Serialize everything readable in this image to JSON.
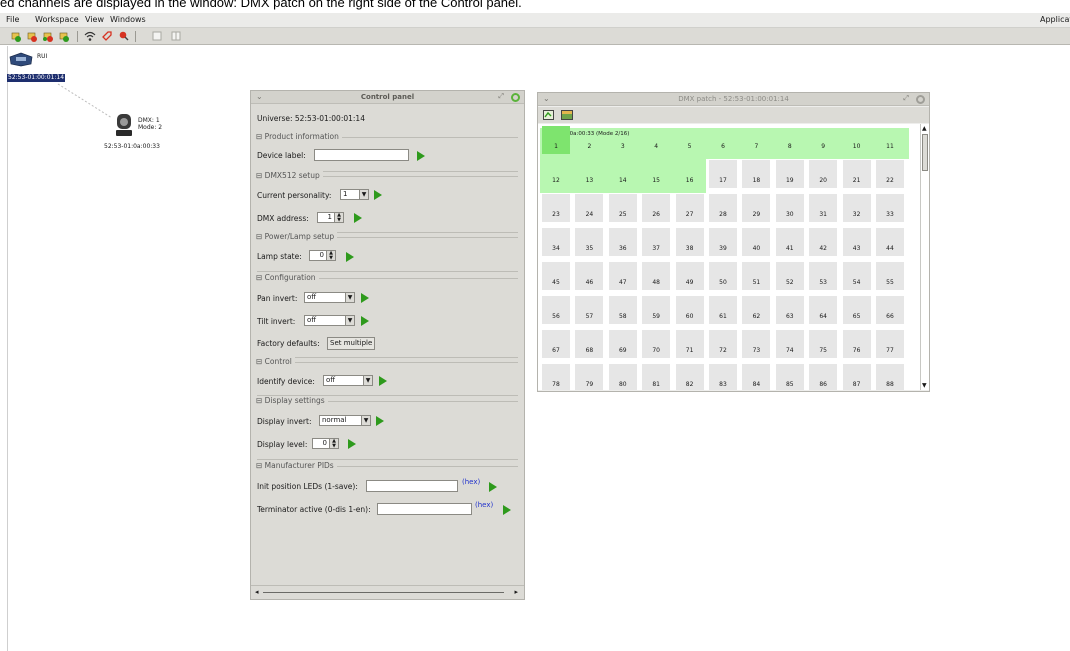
{
  "caption": "ed channels are displayed in the window: DMX patch on the right side of the Control panel.",
  "menu": {
    "file": "File",
    "workspace": "Workspace",
    "view": "View",
    "windows": "Windows",
    "right": "Applicati"
  },
  "toolbar_icons": [
    "add-device-icon",
    "remove-device-icon",
    "device-settings-icon",
    "patch-icon",
    "wifi-icon",
    "tag-icon",
    "pin-icon",
    "doc-icon",
    "grid-icon"
  ],
  "workspace": {
    "rui_label": "RUI",
    "rui_uid": "52:53-01:00:01:14",
    "fixture_dmx": "DMX: 1",
    "fixture_mode": "Mode: 2",
    "fixture_uid": "52:53-01:0a:00:33"
  },
  "control_panel": {
    "title": "Control panel",
    "universe": "Universe: 52:53-01:00:01:14",
    "product_info": "Product information",
    "device_label": "Device label:",
    "device_label_value": "",
    "dmx512_setup": "DMX512 setup",
    "current_personality": "Current personality:",
    "personality_value": "1",
    "dmx_address": "DMX address:",
    "dmx_address_value": "1",
    "power_lamp": "Power/Lamp setup",
    "lamp_state": "Lamp state:",
    "lamp_state_value": "0",
    "configuration": "Configuration",
    "pan_invert": "Pan invert:",
    "pan_invert_value": "off",
    "tilt_invert": "Tilt invert:",
    "tilt_invert_value": "off",
    "factory_defaults": "Factory defaults:",
    "set_multiple": "Set multiple",
    "control": "Control",
    "identify_device": "Identify device:",
    "identify_value": "off",
    "display_settings": "Display settings",
    "display_invert": "Display invert:",
    "display_invert_value": "normal",
    "display_level": "Display level:",
    "display_level_value": "0",
    "manufacturer_pids": "Manufacturer PIDs",
    "init_position": "Init position LEDs (1-save):",
    "init_value": "",
    "terminator": "Terminator active (0-dis 1-en):",
    "terminator_value": "",
    "hex": "(hex)"
  },
  "dmx_patch": {
    "title": "DMX patch - 52:53-01:00:01:14",
    "patched_label": "52:53-01:0a:00:33 (Mode 2/16)",
    "patched_start": 1,
    "patched_count": 16,
    "rows": [
      [
        "1",
        "2",
        "3",
        "4",
        "5",
        "6",
        "7",
        "8",
        "9",
        "10",
        "11"
      ],
      [
        "12",
        "13",
        "14",
        "15",
        "16",
        "17",
        "18",
        "19",
        "20",
        "21",
        "22"
      ],
      [
        "23",
        "24",
        "25",
        "26",
        "27",
        "28",
        "29",
        "30",
        "31",
        "32",
        "33"
      ],
      [
        "34",
        "35",
        "36",
        "37",
        "38",
        "39",
        "40",
        "41",
        "42",
        "43",
        "44"
      ],
      [
        "45",
        "46",
        "47",
        "48",
        "49",
        "50",
        "51",
        "52",
        "53",
        "54",
        "55"
      ],
      [
        "56",
        "57",
        "58",
        "59",
        "60",
        "61",
        "62",
        "63",
        "64",
        "65",
        "66"
      ],
      [
        "67",
        "68",
        "69",
        "70",
        "71",
        "72",
        "73",
        "74",
        "75",
        "76",
        "77"
      ],
      [
        "78",
        "79",
        "80",
        "81",
        "82",
        "83",
        "84",
        "85",
        "86",
        "87",
        "88"
      ]
    ],
    "colors": {
      "patched": "#b8f7b1",
      "selected": "#7ee46e",
      "empty": "#e6e6e6"
    }
  }
}
